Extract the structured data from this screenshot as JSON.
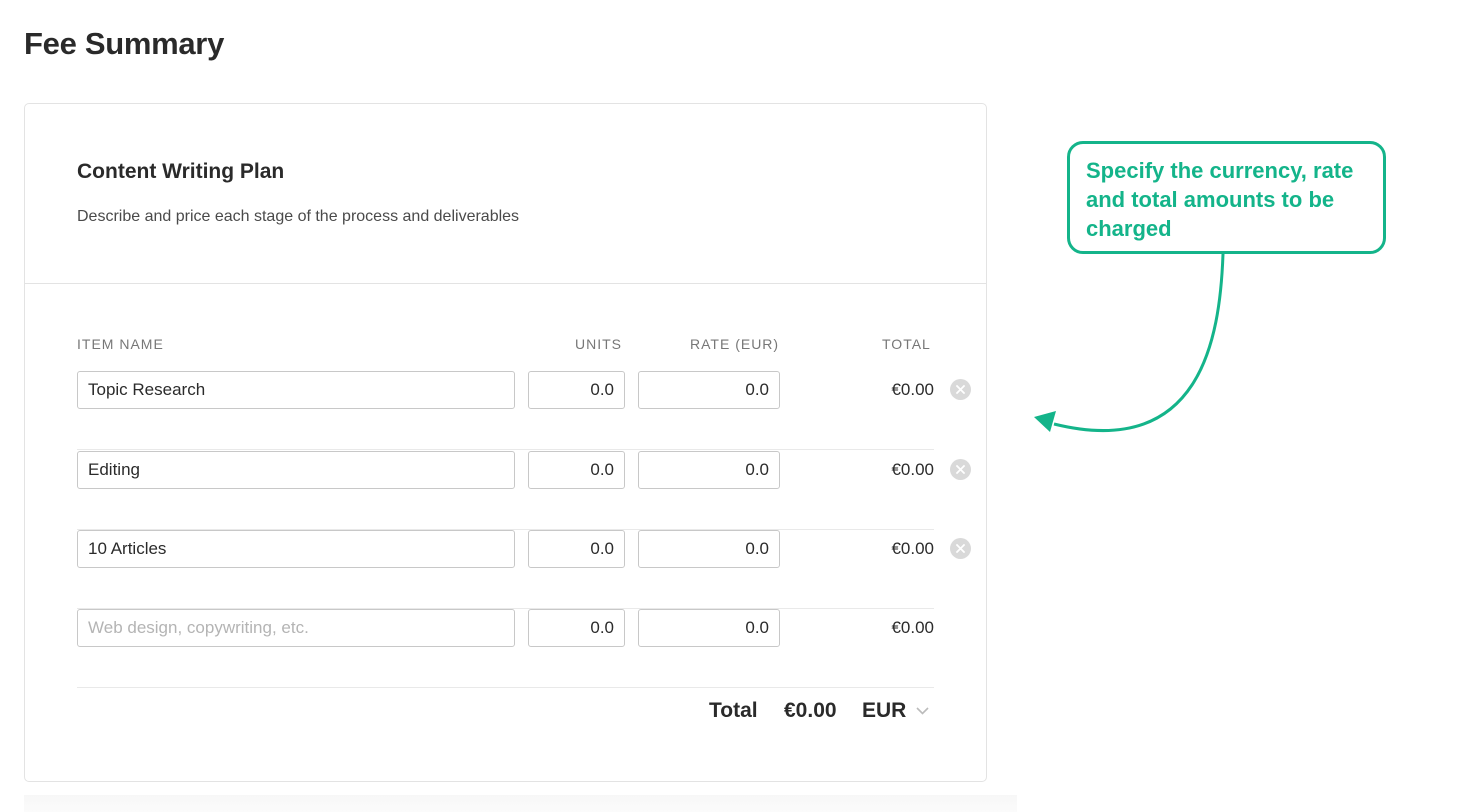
{
  "page": {
    "title": "Fee Summary"
  },
  "plan": {
    "title": "Content Writing Plan",
    "description": "Describe and price each stage of the process and deliverables"
  },
  "table": {
    "headers": {
      "item": "ITEM NAME",
      "units": "UNITS",
      "rate": "RATE (EUR)",
      "total": "TOTAL"
    },
    "rows": [
      {
        "name": "Topic Research",
        "units": "0.0",
        "rate": "0.0",
        "total": "€0.00"
      },
      {
        "name": "Editing",
        "units": "0.0",
        "rate": "0.0",
        "total": "€0.00"
      },
      {
        "name": "10 Articles",
        "units": "0.0",
        "rate": "0.0",
        "total": "€0.00"
      }
    ],
    "new_row": {
      "placeholder": "Web design, copywriting, etc.",
      "units": "0.0",
      "rate": "0.0",
      "total": "€0.00"
    }
  },
  "summary": {
    "label": "Total",
    "value": "€0.00",
    "currency": "EUR"
  },
  "callout": {
    "text": "Specify the currency, rate and total amounts to be charged"
  },
  "icons": {
    "remove": "close-circle-icon",
    "currency_dropdown": "chevron-down-icon",
    "annotation_arrow": "curved-arrow-icon"
  },
  "colors": {
    "accent": "#14b48a",
    "border": "#c8c8c8",
    "remove_icon": "#d9d9d9"
  }
}
